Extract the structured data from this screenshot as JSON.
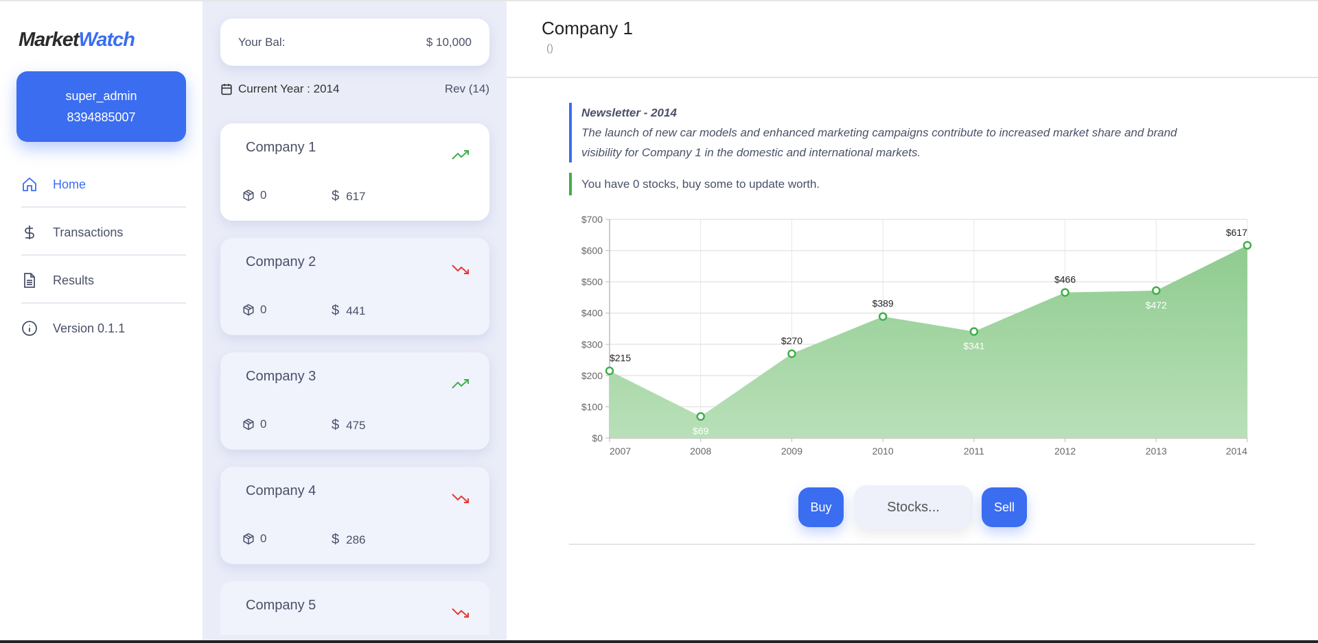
{
  "sidebar": {
    "logo": {
      "part1": "Market",
      "part2": "Watch"
    },
    "user": {
      "name": "super_admin",
      "phone": "8394885007"
    },
    "nav": [
      {
        "label": "Home",
        "icon": "home-icon",
        "active": true
      },
      {
        "label": "Transactions",
        "icon": "dollar-icon"
      },
      {
        "label": "Results",
        "icon": "document-icon"
      },
      {
        "label": "Version 0.1.1",
        "icon": "info-icon"
      }
    ]
  },
  "panel": {
    "balance_label": "Your Bal:",
    "balance_value": "10,000",
    "current_year": "Current Year : 2014",
    "rev": "Rev (14)",
    "companies": [
      {
        "name": "Company 1",
        "stocks": "0",
        "price": "617",
        "trend": "up"
      },
      {
        "name": "Company 2",
        "stocks": "0",
        "price": "441",
        "trend": "down"
      },
      {
        "name": "Company 3",
        "stocks": "0",
        "price": "475",
        "trend": "up"
      },
      {
        "name": "Company 4",
        "stocks": "0",
        "price": "286",
        "trend": "down"
      },
      {
        "name": "Company 5",
        "stocks": "",
        "price": "",
        "trend": "down"
      }
    ]
  },
  "main": {
    "title": "Company 1",
    "subtitle": "()",
    "newsletter_title": "Newsletter - 2014",
    "newsletter_text": "The launch of new car models and enhanced marketing campaigns contribute to increased market share and brand visibility for Company 1 in the domestic and international markets.",
    "holdings_text": "You have 0 stocks, buy some to update worth.",
    "buy_label": "Buy",
    "sell_label": "Sell",
    "stocks_placeholder": "Stocks..."
  },
  "colors": {
    "accent": "#3a6df0",
    "up": "#3fae49",
    "down": "#e53935",
    "area_top": "#8fcb8f",
    "area_bottom": "#b9e0b9"
  },
  "chart_data": {
    "type": "area",
    "categories": [
      "2007",
      "2008",
      "2009",
      "2010",
      "2011",
      "2012",
      "2013",
      "2014"
    ],
    "values": [
      215,
      69,
      270,
      389,
      341,
      466,
      472,
      617
    ],
    "data_labels": [
      "$215",
      "$69",
      "$270",
      "$389",
      "$341",
      "$466",
      "$472",
      "$617"
    ],
    "yticks": [
      "$0",
      "$100",
      "$200",
      "$300",
      "$400",
      "$500",
      "$600",
      "$700"
    ],
    "ylim": [
      0,
      700
    ],
    "grid": true
  }
}
